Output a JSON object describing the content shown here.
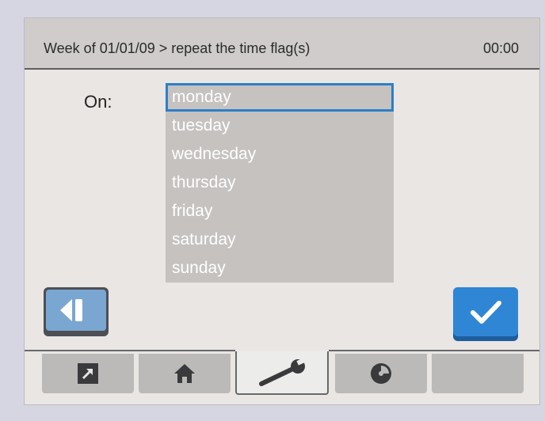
{
  "header": {
    "title": "Week of 01/01/09 > repeat the time flag(s)",
    "time": "00:00"
  },
  "form": {
    "on_label": "On:",
    "days": [
      {
        "label": "monday",
        "selected": true
      },
      {
        "label": "tuesday",
        "selected": false
      },
      {
        "label": "wednesday",
        "selected": false
      },
      {
        "label": "thursday",
        "selected": false
      },
      {
        "label": "friday",
        "selected": false
      },
      {
        "label": "saturday",
        "selected": false
      },
      {
        "label": "sunday",
        "selected": false
      }
    ]
  },
  "buttons": {
    "back_icon": "back-icon",
    "confirm_icon": "checkmark-icon"
  },
  "tabs": [
    {
      "icon": "shortcut-arrow-icon",
      "active": false
    },
    {
      "icon": "home-icon",
      "active": false
    },
    {
      "icon": "wrench-icon",
      "active": true
    },
    {
      "icon": "disc-icon",
      "active": false
    },
    {
      "icon": "",
      "active": false
    }
  ],
  "colors": {
    "accent": "#2f86d4",
    "selection_border": "#2d7fc7",
    "list_background": "#c5c2c0"
  }
}
